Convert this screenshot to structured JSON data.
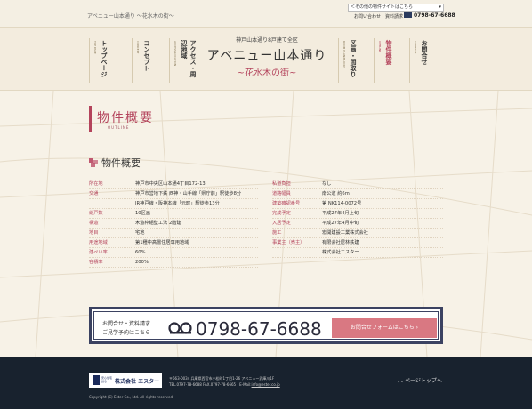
{
  "topbar": {
    "site_tag": "アベニュー山本通り ～花水木の街～",
    "site_select": "＜その他の物件サイトはこちら",
    "inquiry": "お問い合わせ・資料請求",
    "tel": "0798-67-6688"
  },
  "nav": {
    "left_items": [
      {
        "jp": "トップページ",
        "en": "TOP PAGE"
      },
      {
        "jp": "コンセプト",
        "en": "CONCEPT"
      },
      {
        "jp": "アクセス・周辺地域",
        "en": "ACCESS/LOCATION"
      }
    ],
    "right_items": [
      {
        "jp": "区画・間取り",
        "en": "ROOM PLAN/BLOCKS"
      },
      {
        "jp": "物件概要",
        "en": "OUTLINE"
      },
      {
        "jp": "お問合せ",
        "en": "CONTACT"
      }
    ],
    "logo_sub": "神戸山本通り8戸建て全区",
    "logo_main": "アベニュー山本通り",
    "logo_tag": "~花水木の街~"
  },
  "page": {
    "title": "物件概要",
    "subtitle": "OUTLINE",
    "section_heading": "物件概要"
  },
  "spec_left": [
    {
      "key": "所在地",
      "value": "神戸市中央区山本通4丁目172-13"
    },
    {
      "key": "交通",
      "value": "神戸市営地下鉄 西神・山手線「県庁前」駅徒歩8分"
    },
    {
      "key": "",
      "value": "JR神戸線・阪神本線「元町」駅徒歩13分"
    },
    {
      "key": "総戸数",
      "value": "10区画"
    },
    {
      "key": "構造",
      "value": "木造枠組壁工法 2階建"
    },
    {
      "key": "地目",
      "value": "宅地"
    },
    {
      "key": "用途地域",
      "value": "第1種中高層住居専用地域"
    },
    {
      "key": "建ぺい率",
      "value": "60%"
    },
    {
      "key": "容積率",
      "value": "200%"
    }
  ],
  "spec_right": [
    {
      "key": "私道負担",
      "value": "なし"
    },
    {
      "key": "道路幅員",
      "value": "南公道 約6m"
    },
    {
      "key": "建築確認番号",
      "value": "第 NK114-0072号"
    },
    {
      "key": "完成予定",
      "value": "平成27年4月上旬"
    },
    {
      "key": "入居予定",
      "value": "平成27年4月中旬"
    },
    {
      "key": "施工",
      "value": "宏開建設工業株式会社"
    },
    {
      "key": "事業主（売主）",
      "value": "有限会社居林鉄建"
    },
    {
      "key": "",
      "value": "株式会社エスター"
    }
  ],
  "contact": {
    "line1": "お問合せ・資料請求",
    "line2": "ご見学予約はこちら",
    "tel": "0798-67-6688",
    "button": "お問合せフォームはこちら ›"
  },
  "footer": {
    "logo_mark_text": "安心住宅創る",
    "logo_name": "株式会社 エスター",
    "address": "〒663-0034 兵庫県西宮市小松町1丁目1-26 アベニュー武庫川1F",
    "tel_line": "TEL.0797-78-6688 FAX.0797-78-6665　E-Mail:",
    "email": "info@ester.co.jp",
    "pagetop": "ページトップへ",
    "copyright": "Copyright (C) Ester Co., Ltd. All rights reserved."
  },
  "colors": {
    "accent": "#b4445c",
    "navy": "#3b4261",
    "footer_bg": "#18222e",
    "button": "#d97882"
  }
}
